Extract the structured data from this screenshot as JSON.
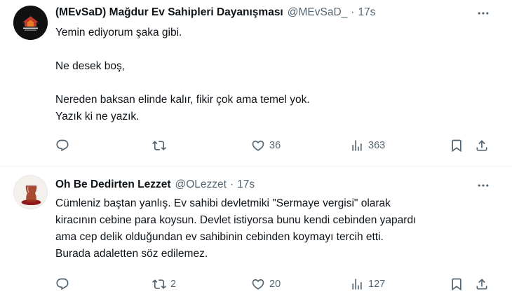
{
  "tweets": [
    {
      "author": "(MEvSaD) Mağdur Ev Sahipleri Dayanışması",
      "handle": "@MEvSaD_",
      "sep": "·",
      "time": "17s",
      "avatar_label": "MEvSaD",
      "lines": [
        "Yemin ediyorum şaka gibi.",
        "",
        "Ne desek boş,",
        "",
        "Nereden baksan elinde kalır, fikir çok ama temel yok.",
        "Yazık ki ne yazık."
      ],
      "stats": {
        "replies": "",
        "retweets": "",
        "likes": "36",
        "views": "363"
      }
    },
    {
      "author": "Oh Be Dedirten Lezzet",
      "handle": "@OLezzet",
      "sep": "·",
      "time": "17s",
      "lines": [
        "Cümleniz baştan yanlış. Ev sahibi devletmiki \"Sermaye vergisi\" olarak",
        "kiracının cebine para koysun. Devlet istiyorsa bunu kendi cebinden yapardı",
        "ama cep delik olduğundan ev sahibinin cebinden koymayı tercih etti.",
        "Burada adaletten söz edilemez."
      ],
      "stats": {
        "replies": "",
        "retweets": "2",
        "likes": "20",
        "views": "127"
      }
    }
  ],
  "icons": {
    "reply": "reply-icon",
    "retweet": "retweet-icon",
    "like": "heart-icon",
    "views": "views-icon",
    "bookmark": "bookmark-icon",
    "share": "share-icon",
    "more": "more-icon"
  },
  "colors": {
    "text": "#0f1419",
    "secondary": "#536471",
    "divider": "#eff3f4"
  }
}
